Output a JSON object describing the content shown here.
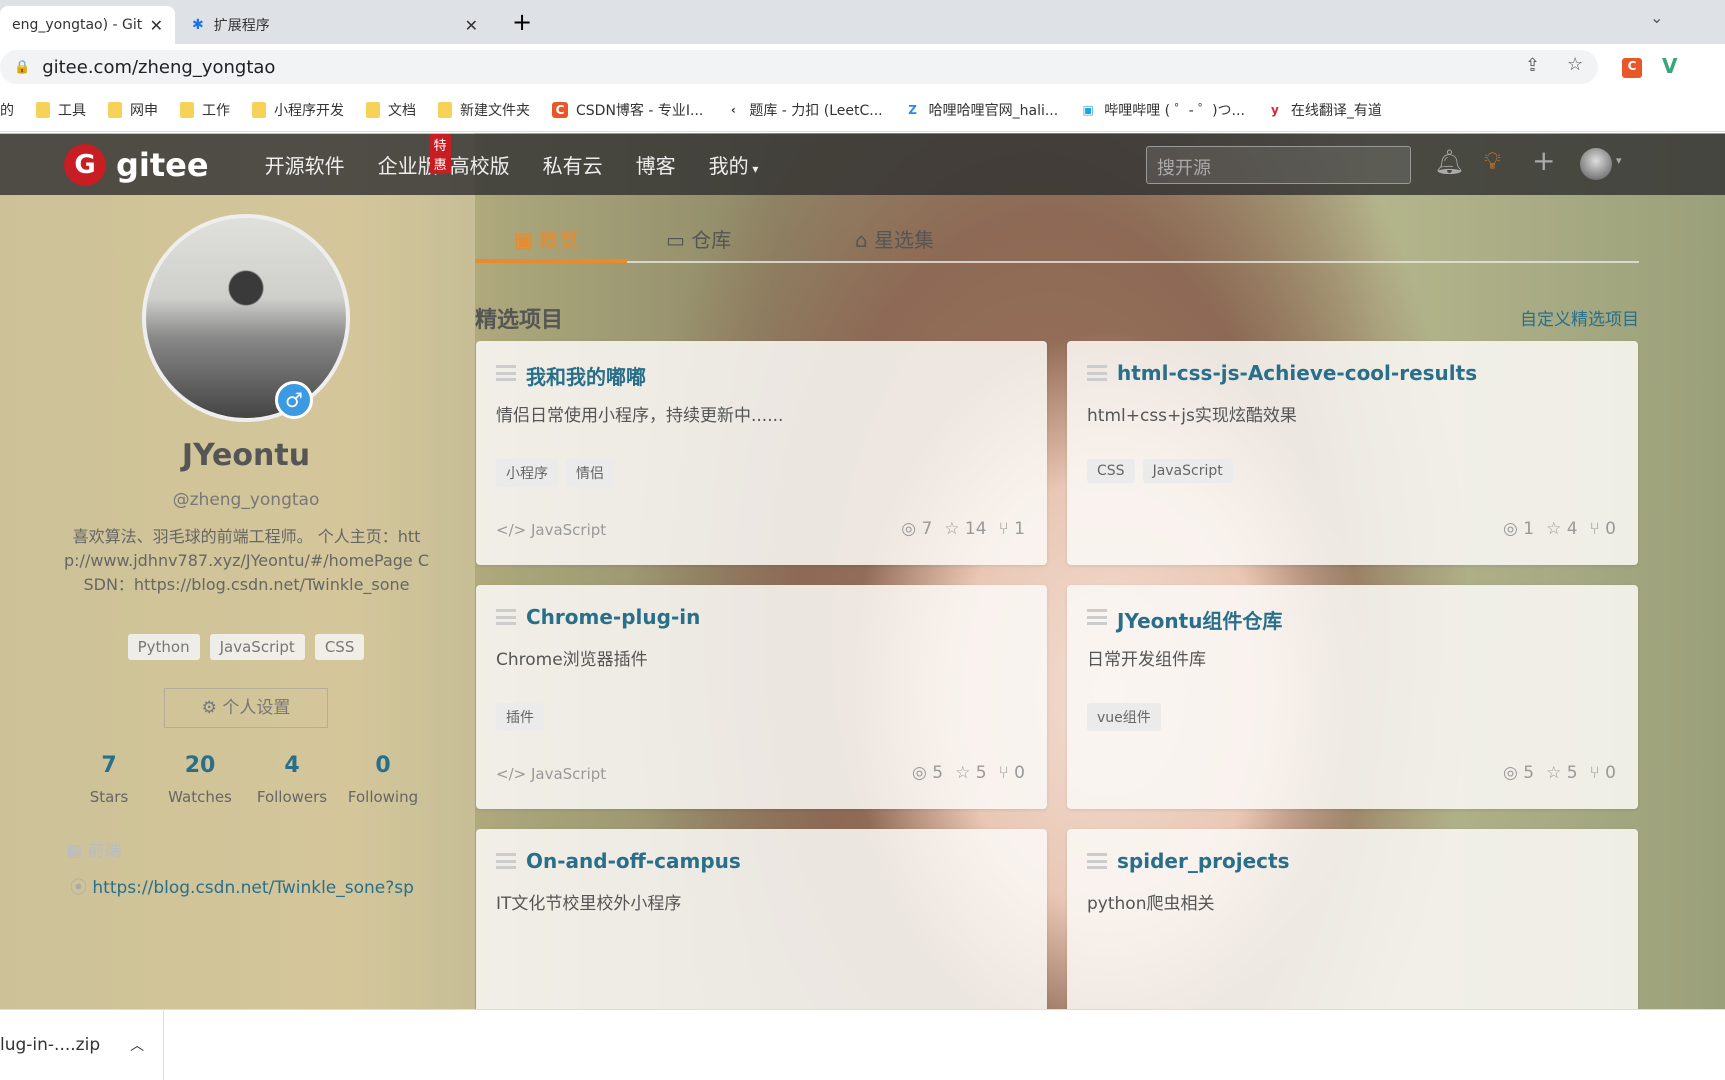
{
  "browser": {
    "tabs": [
      {
        "title": "eng_yongtao) - Git",
        "active": true
      },
      {
        "title": "扩展程序",
        "active": false
      }
    ],
    "url": "gitee.com/zheng_yongtao",
    "bookmarks": [
      "的",
      "工具",
      "网申",
      "工作",
      "小程序开发",
      "文档",
      "新建文件夹",
      "CSDN博客 - 专业I...",
      "题库 - 力扣 (LeetC...",
      "哈哩哈哩官网_hali...",
      "哔哩哔哩 ( ゜- ゜)つ...",
      "在线翻译_有道"
    ]
  },
  "nav": {
    "logo": "gitee",
    "items": [
      "开源软件",
      "企业版",
      "高校版",
      "私有云",
      "博客",
      "我的"
    ],
    "badge": "特惠",
    "search_placeholder": "搜开源"
  },
  "profile": {
    "name": "JYeontu",
    "handle": "@zheng_yongtao",
    "bio": "喜欢算法、羽毛球的前端工程师。 个人主页：http://www.jdhnv787.xyz/JYeontu/#/homePage CSDN：https://blog.csdn.net/Twinkle_sone",
    "tags": [
      "Python",
      "JavaScript",
      "CSS"
    ],
    "settings_label": "个人设置",
    "stats": [
      {
        "value": "7",
        "label": "Stars"
      },
      {
        "value": "20",
        "label": "Watches"
      },
      {
        "value": "4",
        "label": "Followers"
      },
      {
        "value": "0",
        "label": "Following"
      }
    ],
    "department": "前端",
    "link": "https://blog.csdn.net/Twinkle_sone?sp"
  },
  "tabs": [
    "概览",
    "仓库",
    "星选集"
  ],
  "featured": {
    "title": "精选项目",
    "customize": "自定义精选项目",
    "projects": [
      {
        "name": "我和我的嘟嘟",
        "desc": "情侣日常使用小程序，持续更新中......",
        "tags": [
          "小程序",
          "情侣"
        ],
        "lang": "JavaScript",
        "watch": "7",
        "star": "14",
        "fork": "1"
      },
      {
        "name": "html-css-js-Achieve-cool-results",
        "desc": "html+css+js实现炫酷效果",
        "tags": [
          "CSS",
          "JavaScript"
        ],
        "lang": "",
        "watch": "1",
        "star": "4",
        "fork": "0"
      },
      {
        "name": "Chrome-plug-in",
        "desc": "Chrome浏览器插件",
        "tags": [
          "插件"
        ],
        "lang": "JavaScript",
        "watch": "5",
        "star": "5",
        "fork": "0"
      },
      {
        "name": "JYeontu组件仓库",
        "desc": "日常开发组件库",
        "tags": [
          "vue组件"
        ],
        "lang": "",
        "watch": "5",
        "star": "5",
        "fork": "0"
      },
      {
        "name": "On-and-off-campus",
        "desc": "IT文化节校里校外小程序",
        "tags": [],
        "lang": ""
      },
      {
        "name": "spider_projects",
        "desc": "python爬虫相关",
        "tags": [],
        "lang": ""
      }
    ]
  },
  "download": {
    "file": "lug-in-....zip"
  },
  "colors": {
    "accent": "#e98a2d",
    "link": "#2a6f8a",
    "brand": "#c71d23"
  }
}
